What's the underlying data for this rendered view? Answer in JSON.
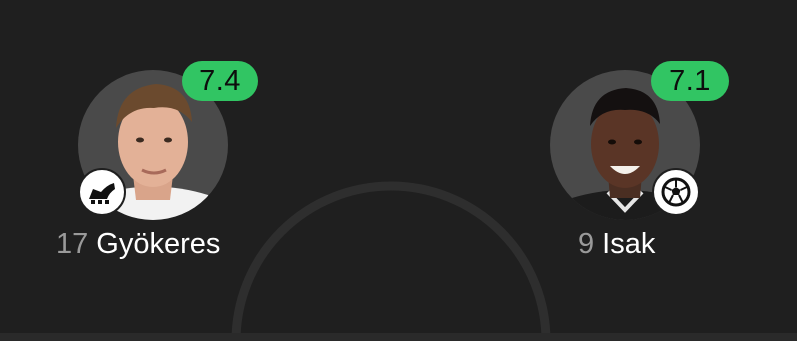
{
  "players": [
    {
      "number": "17",
      "name": "Gyökeres",
      "rating": "7.4",
      "rating_color": "#31c563",
      "event_icon": "boot-icon"
    },
    {
      "number": "9",
      "name": "Isak",
      "rating": "7.1",
      "rating_color": "#31c563",
      "event_icon": "football-icon"
    }
  ],
  "colors": {
    "background": "#1f1f1f",
    "avatar_bg": "#4a4a4a",
    "pitch_line": "#2e2e2e"
  }
}
